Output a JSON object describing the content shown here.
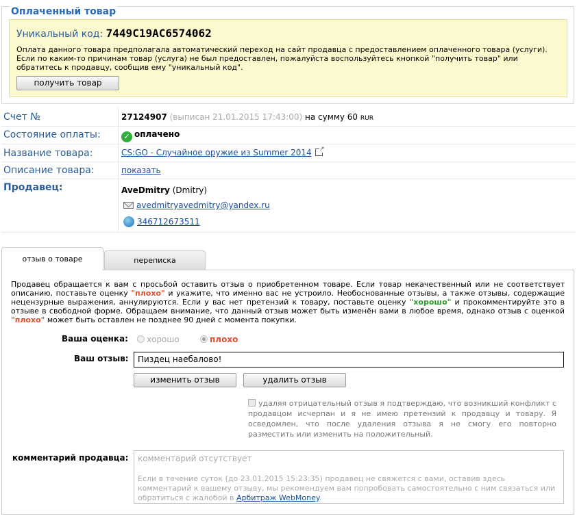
{
  "paid": {
    "legend": "Оплаченный товар",
    "code_label": "Уникальный код:",
    "code_value": "7449C19AC6574062",
    "notice": "Оплата данного товара предполагала автоматический переход на сайт продавца с предоставлением оплаченного товара (услуги). Если по каким-то причинам товар (услуга) не был предоставлен, пожалуйста воспользуйтесь кнопкой \"получить товар\" или обратитесь к продавцу, сообщив ему \"уникальный код\".",
    "get_button": "получить товар"
  },
  "invoice": {
    "label": "Счет №",
    "number": "27124907",
    "issued": "(выписан 21.01.2015 17:43:00)",
    "sum_prefix": "на сумму 60",
    "currency": "RUR"
  },
  "payment": {
    "label": "Состояние оплаты:",
    "status": "оплачено",
    "status_color": "#2eae3a"
  },
  "product": {
    "label": "Название товара:",
    "name": "CS:GO - Случайное оружие из Summer 2014"
  },
  "description": {
    "label": "Описание товара:",
    "link": "показать"
  },
  "seller": {
    "label": "Продавец:",
    "nick": "AveDmitry",
    "name": "(Dmitry)",
    "email": "avedmitryavedmitry@yandex.ru",
    "wmid": "346712673511"
  },
  "tabs": [
    {
      "label": "отзыв о товаре",
      "active": true
    },
    {
      "label": "переписка",
      "active": false
    }
  ],
  "review": {
    "intro_1": "Продавец обращается к вам с просьбой оставить отзыв о приобретенном товаре. Если товар некачественный или не соответствует описанию, поставьте оценку",
    "bad_word": "\"плохо\"",
    "intro_2": "и укажите, что именно вас не устроило. Необоснованные отзывы, а также отзывы, содержащие нецензурные выражения, аннулируются. Если у вас нет претензий к товару, поставьте оценку",
    "good_word": "\"хорошо\"",
    "intro_3": "и прокомментируйте это в отзыве в свободной форме. Обращаем внимание, что данный отзыв может быть изменён вами в любое время, однако отзыв с оценкой",
    "bad_word_2": "\"плохо\"",
    "intro_4": "может быть оставлен не позднее 90 дней с момента покупки.",
    "rating_label": "Ваша оценка:",
    "rating_good": "хорошо",
    "rating_bad": "плохо",
    "rating_selected": "плохо",
    "review_label": "Ваш отзыв:",
    "review_value": "Пиздец наебалово!",
    "edit_button": "изменить отзыв",
    "delete_button": "удалить отзыв",
    "confirm_text": "удаляя отрицательный отзыв я подтверждаю, что возникший конфликт с продавцом исчерпан и я не имею претензий к продавцу и товару. Я осведомлен, что после удаления отзыва я не смогу его повторно разместить или изменить на положительный.",
    "comment_label": "комментарий продавца:",
    "comment_placeholder": "комментарий отсутствует",
    "comment_note": "Если в течение суток (до 23.01.2015 15:23:35) продавец не свяжется с вами, оставив здесь комментарий к вашему отзыву, мы рекомендуем вам попробовать самостоятельно с ним связаться или обратиться с жалобой в",
    "arbitrage_link": "Арбитраж WebMoney",
    "comment_note_end": "."
  }
}
